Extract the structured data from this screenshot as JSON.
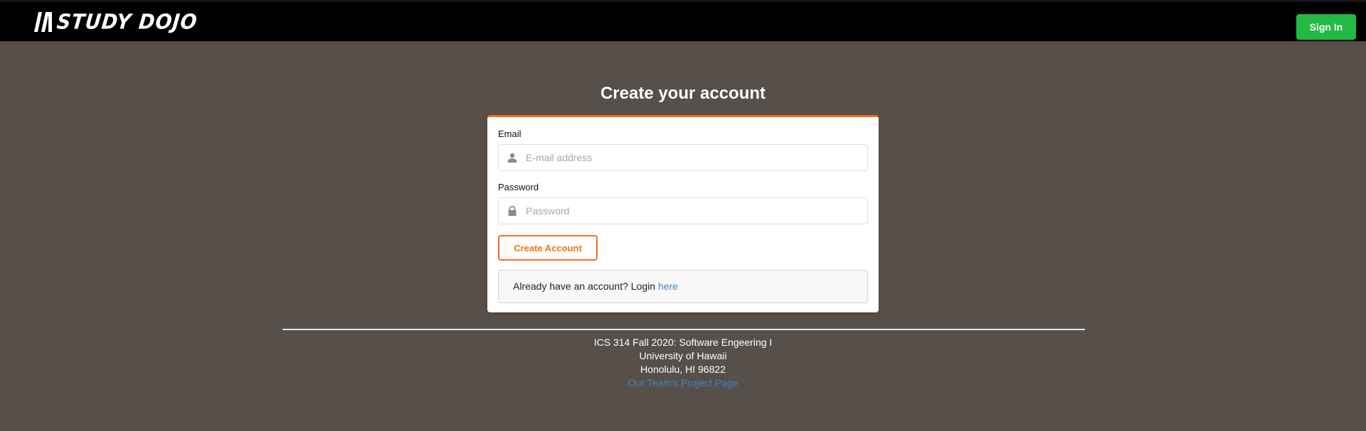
{
  "navbar": {
    "brand_text": "STUDY DOJO",
    "signin_label": "Sign In",
    "signin_color": "#21ba45"
  },
  "page": {
    "title": "Create your account"
  },
  "form": {
    "email_label": "Email",
    "email_placeholder": "E-mail address",
    "email_icon": "user-icon",
    "password_label": "Password",
    "password_placeholder": "Password",
    "password_icon": "lock-icon",
    "submit_label": "Create Account",
    "accent_color": "#f2711c"
  },
  "login_prompt": {
    "text": "Already have an account? Login ",
    "link_text": "here"
  },
  "footer": {
    "line1": "ICS 314 Fall 2020: Software Engeering I",
    "line2": "University of Hawaii",
    "line3": "Honolulu, HI 96822",
    "link_text": "Our Team's Project Page",
    "link_color": "#4183c4"
  }
}
